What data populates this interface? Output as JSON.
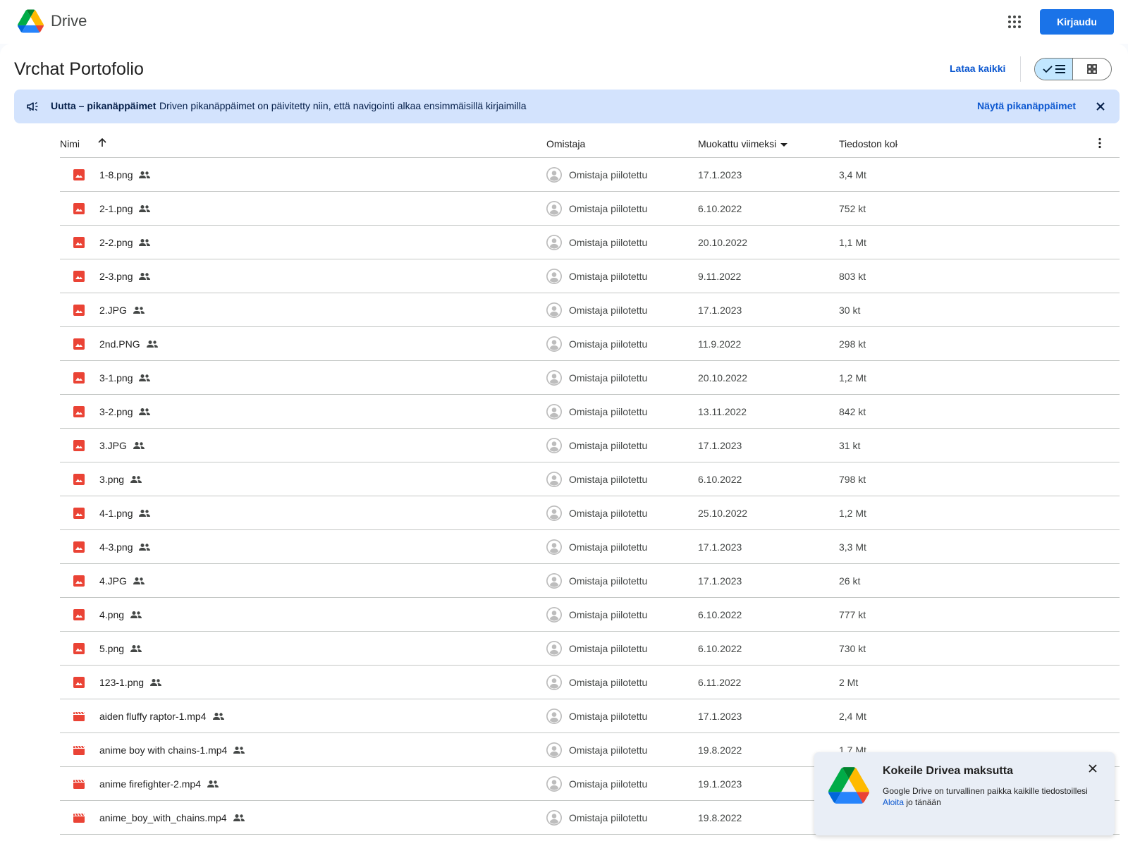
{
  "header": {
    "brand": "Drive",
    "logo_icon": "google-drive-logo",
    "apps_icon": "apps-grid-icon",
    "signin_label": "Kirjaudu"
  },
  "folder": {
    "title": "Vrchat Portofolio",
    "download_all_label": "Lataa kaikki",
    "view_mode": "list"
  },
  "banner": {
    "title": "Uutta – pikanäppäimet",
    "text": "Driven pikanäppäimet on päivitetty niin, että navigointi alkaa ensimmäisillä kirjaimilla",
    "link_label": "Näytä pikanäppäimet"
  },
  "columns": {
    "name": "Nimi",
    "owner": "Omistaja",
    "modified": "Muokattu viimeksi",
    "size": "Tiedoston koko"
  },
  "files": [
    {
      "name": "1-8.png",
      "type": "image",
      "owner": "Omistaja piilotettu",
      "modified": "17.1.2023",
      "size": "3,4 Mt"
    },
    {
      "name": "2-1.png",
      "type": "image",
      "owner": "Omistaja piilotettu",
      "modified": "6.10.2022",
      "size": "752 kt"
    },
    {
      "name": "2-2.png",
      "type": "image",
      "owner": "Omistaja piilotettu",
      "modified": "20.10.2022",
      "size": "1,1 Mt"
    },
    {
      "name": "2-3.png",
      "type": "image",
      "owner": "Omistaja piilotettu",
      "modified": "9.11.2022",
      "size": "803 kt"
    },
    {
      "name": "2.JPG",
      "type": "image",
      "owner": "Omistaja piilotettu",
      "modified": "17.1.2023",
      "size": "30 kt"
    },
    {
      "name": "2nd.PNG",
      "type": "image",
      "owner": "Omistaja piilotettu",
      "modified": "11.9.2022",
      "size": "298 kt"
    },
    {
      "name": "3-1.png",
      "type": "image",
      "owner": "Omistaja piilotettu",
      "modified": "20.10.2022",
      "size": "1,2 Mt"
    },
    {
      "name": "3-2.png",
      "type": "image",
      "owner": "Omistaja piilotettu",
      "modified": "13.11.2022",
      "size": "842 kt"
    },
    {
      "name": "3.JPG",
      "type": "image",
      "owner": "Omistaja piilotettu",
      "modified": "17.1.2023",
      "size": "31 kt"
    },
    {
      "name": "3.png",
      "type": "image",
      "owner": "Omistaja piilotettu",
      "modified": "6.10.2022",
      "size": "798 kt"
    },
    {
      "name": "4-1.png",
      "type": "image",
      "owner": "Omistaja piilotettu",
      "modified": "25.10.2022",
      "size": "1,2 Mt"
    },
    {
      "name": "4-3.png",
      "type": "image",
      "owner": "Omistaja piilotettu",
      "modified": "17.1.2023",
      "size": "3,3 Mt"
    },
    {
      "name": "4.JPG",
      "type": "image",
      "owner": "Omistaja piilotettu",
      "modified": "17.1.2023",
      "size": "26 kt"
    },
    {
      "name": "4.png",
      "type": "image",
      "owner": "Omistaja piilotettu",
      "modified": "6.10.2022",
      "size": "777 kt"
    },
    {
      "name": "5.png",
      "type": "image",
      "owner": "Omistaja piilotettu",
      "modified": "6.10.2022",
      "size": "730 kt"
    },
    {
      "name": "123-1.png",
      "type": "image",
      "owner": "Omistaja piilotettu",
      "modified": "6.11.2022",
      "size": "2 Mt"
    },
    {
      "name": "aiden fluffy raptor-1.mp4",
      "type": "video",
      "owner": "Omistaja piilotettu",
      "modified": "17.1.2023",
      "size": "2,4 Mt"
    },
    {
      "name": "anime boy with chains-1.mp4",
      "type": "video",
      "owner": "Omistaja piilotettu",
      "modified": "19.8.2022",
      "size": "1,7 Mt"
    },
    {
      "name": "anime firefighter-2.mp4",
      "type": "video",
      "owner": "Omistaja piilotettu",
      "modified": "19.1.2023",
      "size": ""
    },
    {
      "name": "anime_boy_with_chains.mp4",
      "type": "video",
      "owner": "Omistaja piilotettu",
      "modified": "19.8.2022",
      "size": ""
    }
  ],
  "promo": {
    "title": "Kokeile Drivea maksutta",
    "text": "Google Drive on turvallinen paikka kaikille tiedostoillesi",
    "link_label": "Aloita",
    "link_suffix": " jo tänään"
  },
  "colors": {
    "accent": "#1a73e8",
    "banner_bg": "#d3e3fd",
    "image_icon": "#ea4335",
    "video_icon": "#ea4335",
    "selected_toggle": "#c2e7ff"
  }
}
